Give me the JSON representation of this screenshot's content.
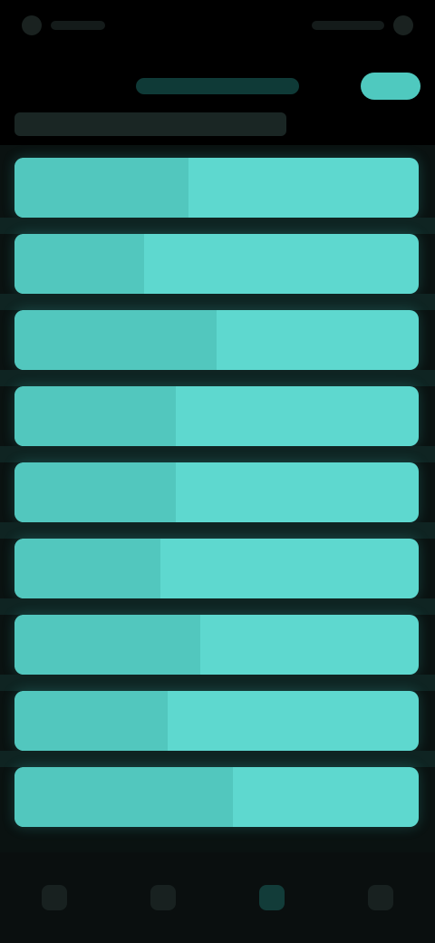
{
  "status_bar": {
    "time": "",
    "icons": [
      "signal-icon",
      "wifi-icon",
      "battery-icon"
    ]
  },
  "header": {
    "title": "",
    "action_label": ""
  },
  "subheader": {
    "text": ""
  },
  "list": {
    "items": [
      {
        "label": "",
        "highlight": 0.43
      },
      {
        "label": "",
        "highlight": 0.32
      },
      {
        "label": "",
        "highlight": 0.5
      },
      {
        "label": "",
        "highlight": 0.4
      },
      {
        "label": "",
        "highlight": 0.4
      },
      {
        "label": "",
        "highlight": 0.36
      },
      {
        "label": "",
        "highlight": 0.46
      },
      {
        "label": "",
        "highlight": 0.38
      },
      {
        "label": "",
        "highlight": 0.54
      }
    ]
  },
  "bottom_nav": {
    "items": [
      {
        "icon": "home-icon",
        "active": false
      },
      {
        "icon": "list-icon",
        "active": false
      },
      {
        "icon": "chart-icon",
        "active": true
      },
      {
        "icon": "settings-icon",
        "active": false
      }
    ]
  },
  "colors": {
    "accent": "#5ed8cf",
    "accent_dark": "#52c7be",
    "background": "#000000",
    "list_background": "#0a1211"
  }
}
